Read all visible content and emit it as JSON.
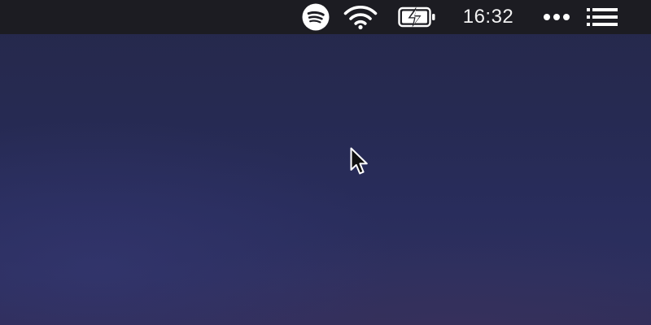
{
  "menubar": {
    "status_items": [
      {
        "icon": "spotify-icon"
      },
      {
        "icon": "wifi-icon"
      },
      {
        "icon": "battery-charging-icon"
      },
      {
        "icon": "more-icon"
      },
      {
        "icon": "list-icon"
      }
    ],
    "clock": "16:32"
  },
  "colors": {
    "menubar_bg": "#1c1c22",
    "icon": "#ffffff",
    "desktop_top": "#25284a",
    "desktop_bottom": "#2f2d58"
  },
  "cursor": {
    "icon": "mouse-pointer-icon"
  }
}
